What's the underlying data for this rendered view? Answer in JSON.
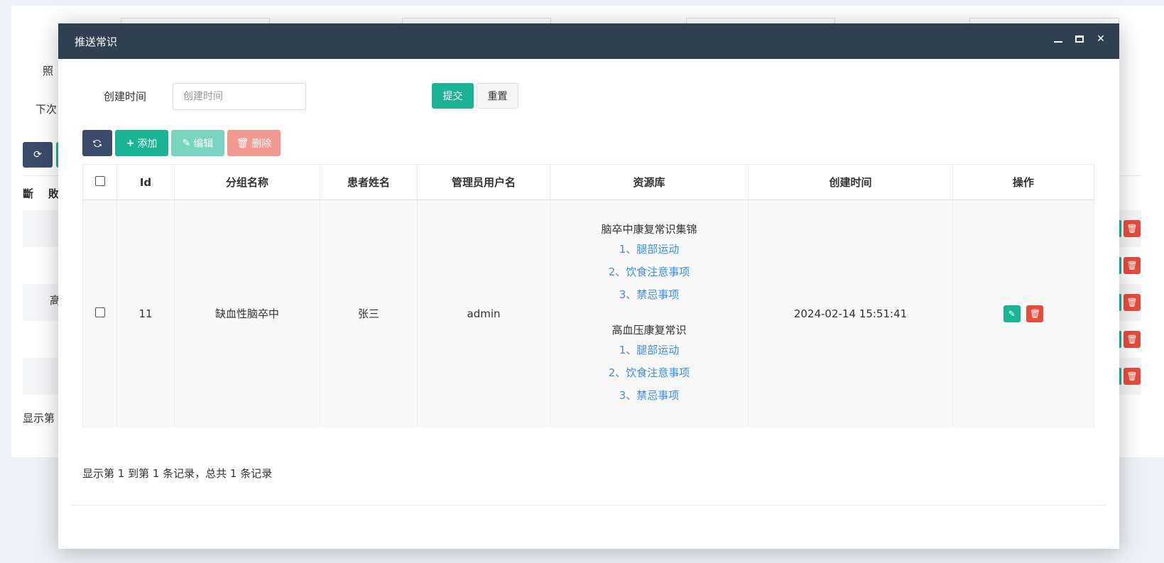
{
  "background": {
    "labels": [
      "照",
      "下次",
      "显示第"
    ],
    "headers": [
      "斷",
      "敗"
    ],
    "row_text": "高"
  },
  "modal": {
    "title": "推送常识",
    "controls": {
      "minimize": "–",
      "maximize": "□",
      "close": "✕"
    },
    "search": {
      "label": "创建时间",
      "placeholder": "创建时间",
      "submit": "提交",
      "reset": "重置"
    },
    "toolbar": {
      "refresh_icon": "refresh-icon",
      "add": "添加",
      "edit": "编辑",
      "delete": "删除"
    },
    "table": {
      "headers": [
        "Id",
        "分组名称",
        "患者姓名",
        "管理员用户名",
        "资源库",
        "创建时间",
        "操作"
      ],
      "rows": [
        {
          "id": "11",
          "group": "缺血性脑卒中",
          "patient": "张三",
          "admin": "admin",
          "resources": [
            {
              "title": "脑卒中康复常识集锦",
              "items": [
                "1、腿部运动",
                "2、饮食注意事项",
                "3、禁忌事项"
              ]
            },
            {
              "title": "高血压康复常识",
              "items": [
                "1、腿部运动",
                "2、饮食注意事项",
                "3、禁忌事项"
              ]
            }
          ],
          "created": "2024-02-14 15:51:41"
        }
      ]
    },
    "pagination": "显示第 1 到第 1 条记录，总共 1 条记录"
  },
  "colors": {
    "header_bg": "#2f4050",
    "primary": "#1ab394",
    "danger": "#e74c3c",
    "link": "#3a8ee6"
  }
}
